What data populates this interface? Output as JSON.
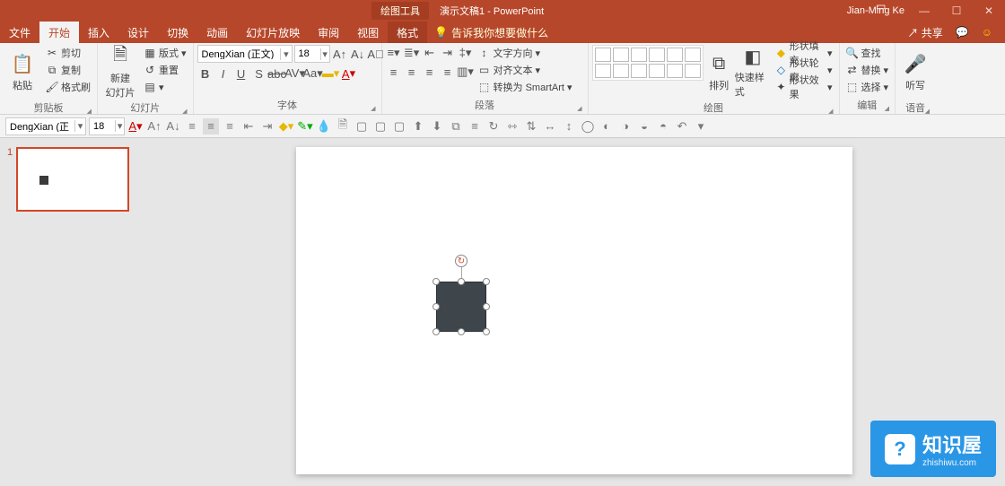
{
  "title": {
    "tools": "绘图工具",
    "doc": "演示文稿1  -  PowerPoint",
    "user": "Jian-Ming Ke"
  },
  "tabs": {
    "file": "文件",
    "home": "开始",
    "insert": "插入",
    "design": "设计",
    "transitions": "切换",
    "animations": "动画",
    "slideshow": "幻灯片放映",
    "review": "审阅",
    "view": "视图",
    "format": "格式"
  },
  "tellme": "告诉我你想要做什么",
  "share": "共享",
  "ribbon": {
    "clipboard": {
      "label": "剪贴板",
      "paste": "粘贴",
      "cut": "剪切",
      "copy": "复制",
      "painter": "格式刷"
    },
    "slides": {
      "label": "幻灯片",
      "new": "新建\n幻灯片",
      "layout": "版式",
      "reset": "重置"
    },
    "font": {
      "label": "字体",
      "name": "DengXian (正文)",
      "size": "18"
    },
    "paragraph": {
      "label": "段落",
      "textdir": "文字方向",
      "align": "对齐文本",
      "smartart": "转换为 SmartArt"
    },
    "drawing": {
      "label": "绘图",
      "arrange": "排列",
      "quickstyles": "快速样式",
      "fill": "形状填充",
      "outline": "形状轮廓",
      "effects": "形状效果"
    },
    "editing": {
      "label": "编辑",
      "find": "查找",
      "replace": "替换",
      "select": "选择"
    },
    "voice": {
      "label": "语音",
      "dictate": "听写"
    }
  },
  "qat": {
    "font": "DengXian (正",
    "size": "18"
  },
  "thumb": {
    "num": "1"
  },
  "watermark": {
    "title": "知识屋",
    "url": "zhishiwu.com"
  }
}
